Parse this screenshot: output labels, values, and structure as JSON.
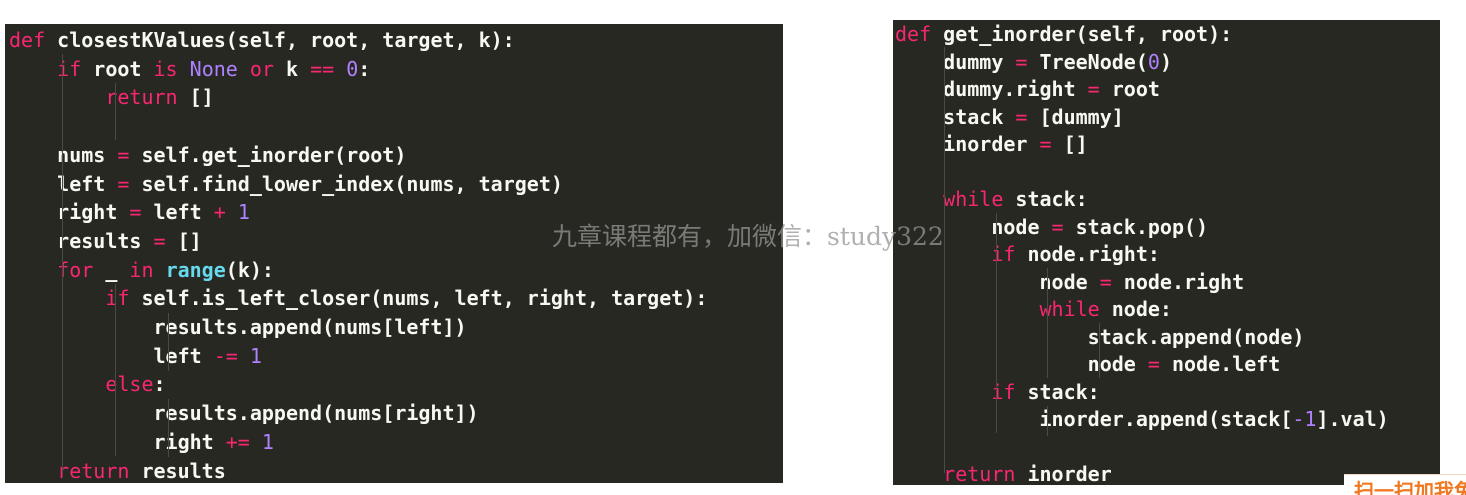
{
  "colors": {
    "background": "#272822",
    "keyword": "#f92672",
    "builtin": "#ae81ff",
    "function": "#66d9ef",
    "text": "#f8f8f2"
  },
  "left_panel": {
    "lines": [
      [
        {
          "t": "def",
          "c": "kw"
        },
        {
          "t": " closestKValues(self, root, target, k):",
          "c": "tx"
        }
      ],
      [
        {
          "t": "    ",
          "c": "tx"
        },
        {
          "t": "if",
          "c": "kw"
        },
        {
          "t": " root ",
          "c": "tx"
        },
        {
          "t": "is",
          "c": "kw"
        },
        {
          "t": " ",
          "c": "tx"
        },
        {
          "t": "None",
          "c": "bi"
        },
        {
          "t": " ",
          "c": "tx"
        },
        {
          "t": "or",
          "c": "kw"
        },
        {
          "t": " k ",
          "c": "tx"
        },
        {
          "t": "==",
          "c": "op"
        },
        {
          "t": " ",
          "c": "tx"
        },
        {
          "t": "0",
          "c": "num"
        },
        {
          "t": ":",
          "c": "tx"
        }
      ],
      [
        {
          "t": "        ",
          "c": "tx"
        },
        {
          "t": "return",
          "c": "kw"
        },
        {
          "t": " []",
          "c": "tx"
        }
      ],
      [],
      [
        {
          "t": "    nums ",
          "c": "tx"
        },
        {
          "t": "=",
          "c": "op"
        },
        {
          "t": " self.get_inorder(root)",
          "c": "tx"
        }
      ],
      [
        {
          "t": "    left ",
          "c": "tx"
        },
        {
          "t": "=",
          "c": "op"
        },
        {
          "t": " self.find_lower_index(nums, target)",
          "c": "tx"
        }
      ],
      [
        {
          "t": "    right ",
          "c": "tx"
        },
        {
          "t": "=",
          "c": "op"
        },
        {
          "t": " left ",
          "c": "tx"
        },
        {
          "t": "+",
          "c": "op"
        },
        {
          "t": " ",
          "c": "tx"
        },
        {
          "t": "1",
          "c": "num"
        }
      ],
      [
        {
          "t": "    results ",
          "c": "tx"
        },
        {
          "t": "=",
          "c": "op"
        },
        {
          "t": " []",
          "c": "tx"
        }
      ],
      [
        {
          "t": "    ",
          "c": "tx"
        },
        {
          "t": "for",
          "c": "kw"
        },
        {
          "t": " _ ",
          "c": "tx"
        },
        {
          "t": "in",
          "c": "kw"
        },
        {
          "t": " ",
          "c": "tx"
        },
        {
          "t": "range",
          "c": "fn"
        },
        {
          "t": "(k):",
          "c": "tx"
        }
      ],
      [
        {
          "t": "        ",
          "c": "tx"
        },
        {
          "t": "if",
          "c": "kw"
        },
        {
          "t": " self.is_left_closer(nums, left, right, target):",
          "c": "tx"
        }
      ],
      [
        {
          "t": "            results.append(nums[left])",
          "c": "tx"
        }
      ],
      [
        {
          "t": "            left ",
          "c": "tx"
        },
        {
          "t": "-=",
          "c": "op"
        },
        {
          "t": " ",
          "c": "tx"
        },
        {
          "t": "1",
          "c": "num"
        }
      ],
      [
        {
          "t": "        ",
          "c": "tx"
        },
        {
          "t": "else",
          "c": "kw"
        },
        {
          "t": ":",
          "c": "tx"
        }
      ],
      [
        {
          "t": "            results.append(nums[right])",
          "c": "tx"
        }
      ],
      [
        {
          "t": "            right ",
          "c": "tx"
        },
        {
          "t": "+=",
          "c": "op"
        },
        {
          "t": " ",
          "c": "tx"
        },
        {
          "t": "1",
          "c": "num"
        }
      ],
      [
        {
          "t": "    ",
          "c": "tx"
        },
        {
          "t": "return",
          "c": "kw"
        },
        {
          "t": " results",
          "c": "tx"
        }
      ]
    ]
  },
  "right_panel": {
    "lines": [
      [
        {
          "t": "def",
          "c": "kw"
        },
        {
          "t": " get_inorder(self, root):",
          "c": "tx"
        }
      ],
      [
        {
          "t": "    dummy ",
          "c": "tx"
        },
        {
          "t": "=",
          "c": "op"
        },
        {
          "t": " TreeNode(",
          "c": "tx"
        },
        {
          "t": "0",
          "c": "num"
        },
        {
          "t": ")",
          "c": "tx"
        }
      ],
      [
        {
          "t": "    dummy.right ",
          "c": "tx"
        },
        {
          "t": "=",
          "c": "op"
        },
        {
          "t": " root",
          "c": "tx"
        }
      ],
      [
        {
          "t": "    stack ",
          "c": "tx"
        },
        {
          "t": "=",
          "c": "op"
        },
        {
          "t": " [dummy]",
          "c": "tx"
        }
      ],
      [
        {
          "t": "    inorder ",
          "c": "tx"
        },
        {
          "t": "=",
          "c": "op"
        },
        {
          "t": " []",
          "c": "tx"
        }
      ],
      [],
      [
        {
          "t": "    ",
          "c": "tx"
        },
        {
          "t": "while",
          "c": "kw"
        },
        {
          "t": " stack:",
          "c": "tx"
        }
      ],
      [
        {
          "t": "        node ",
          "c": "tx"
        },
        {
          "t": "=",
          "c": "op"
        },
        {
          "t": " stack.pop()",
          "c": "tx"
        }
      ],
      [
        {
          "t": "        ",
          "c": "tx"
        },
        {
          "t": "if",
          "c": "kw"
        },
        {
          "t": " node.right:",
          "c": "tx"
        }
      ],
      [
        {
          "t": "            node ",
          "c": "tx"
        },
        {
          "t": "=",
          "c": "op"
        },
        {
          "t": " node.right",
          "c": "tx"
        }
      ],
      [
        {
          "t": "            ",
          "c": "tx"
        },
        {
          "t": "while",
          "c": "kw"
        },
        {
          "t": " node:",
          "c": "tx"
        }
      ],
      [
        {
          "t": "                stack.append(node)",
          "c": "tx"
        }
      ],
      [
        {
          "t": "                node ",
          "c": "tx"
        },
        {
          "t": "=",
          "c": "op"
        },
        {
          "t": " node.left",
          "c": "tx"
        }
      ],
      [
        {
          "t": "        ",
          "c": "tx"
        },
        {
          "t": "if",
          "c": "kw"
        },
        {
          "t": " stack:",
          "c": "tx"
        }
      ],
      [
        {
          "t": "            inorder.append(stack[",
          "c": "tx"
        },
        {
          "t": "-1",
          "c": "num"
        },
        {
          "t": "].val)",
          "c": "tx"
        }
      ],
      [],
      [
        {
          "t": "    ",
          "c": "tx"
        },
        {
          "t": "return",
          "c": "kw"
        },
        {
          "t": " inorder",
          "c": "tx"
        }
      ]
    ]
  },
  "watermark": {
    "text": "九章课程都有，加微信：study322"
  },
  "corner_badge": {
    "text": "扫一扫加我免费"
  }
}
